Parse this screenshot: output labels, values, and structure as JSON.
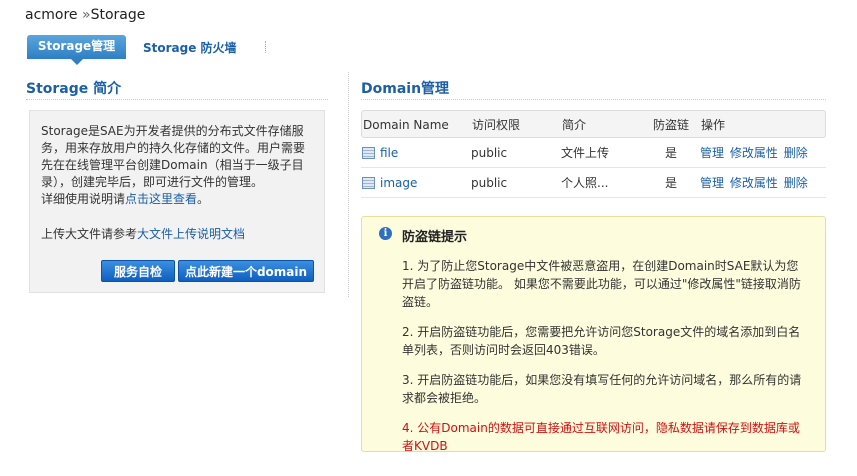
{
  "breadcrumb": {
    "root": "acmore",
    "sep": "»",
    "current": "Storage"
  },
  "tabs": [
    {
      "label": "Storage管理",
      "active": true
    },
    {
      "label": "Storage 防火墙",
      "active": false
    }
  ],
  "intro": {
    "heading": "Storage 简介",
    "body": "Storage是SAE为开发者提供的分布式文件存储服务，用来存放用户的持久化存储的文件。用户需要先在在线管理平台创建Domain（相当于一级子目录），创建完毕后，即可进行文件的管理。",
    "detail_prefix": "详细使用说明请",
    "detail_link": "点击这里查看",
    "detail_suffix": "。",
    "upload_prefix": "上传大文件请参考",
    "upload_link": "大文件上传说明文档",
    "btn_selfcheck": "服务自检",
    "btn_new_domain": "点此新建一个domain"
  },
  "domain": {
    "heading": "Domain管理",
    "columns": [
      "Domain Name",
      "访问权限",
      "简介",
      "防盗链",
      "操作"
    ],
    "rows": [
      {
        "name": "file",
        "access": "public",
        "desc": "文件上传",
        "hotlink": "是",
        "actions": [
          "管理",
          "修改属性",
          "删除"
        ]
      },
      {
        "name": "image",
        "access": "public",
        "desc": "个人照...",
        "hotlink": "是",
        "actions": [
          "管理",
          "修改属性",
          "删除"
        ]
      }
    ]
  },
  "notice": {
    "title": "防盗链提示",
    "items": [
      "1. 为了防止您Storage中文件被恶意盗用，在创建Domain时SAE默认为您开启了防盗链功能。 如果您不需要此功能，可以通过\"修改属性\"链接取消防盗链。",
      "2. 开启防盗链功能后，您需要把允许访问您Storage文件的域名添加到白名单列表，否则访问时会返回403错误。",
      "3. 开启防盗链功能后，如果您没有填写任何的允许访问域名，那么所有的请求都会被拒绝。",
      "4. 公有Domain的数据可直接通过互联网访问，隐私数据请保存到数据库或者KVDB"
    ]
  },
  "colors": {
    "accent": "#1a5fa8",
    "tab_bg": "#2e7fc4",
    "notice_bg": "#fdfcdd",
    "warn": "#d01010"
  }
}
